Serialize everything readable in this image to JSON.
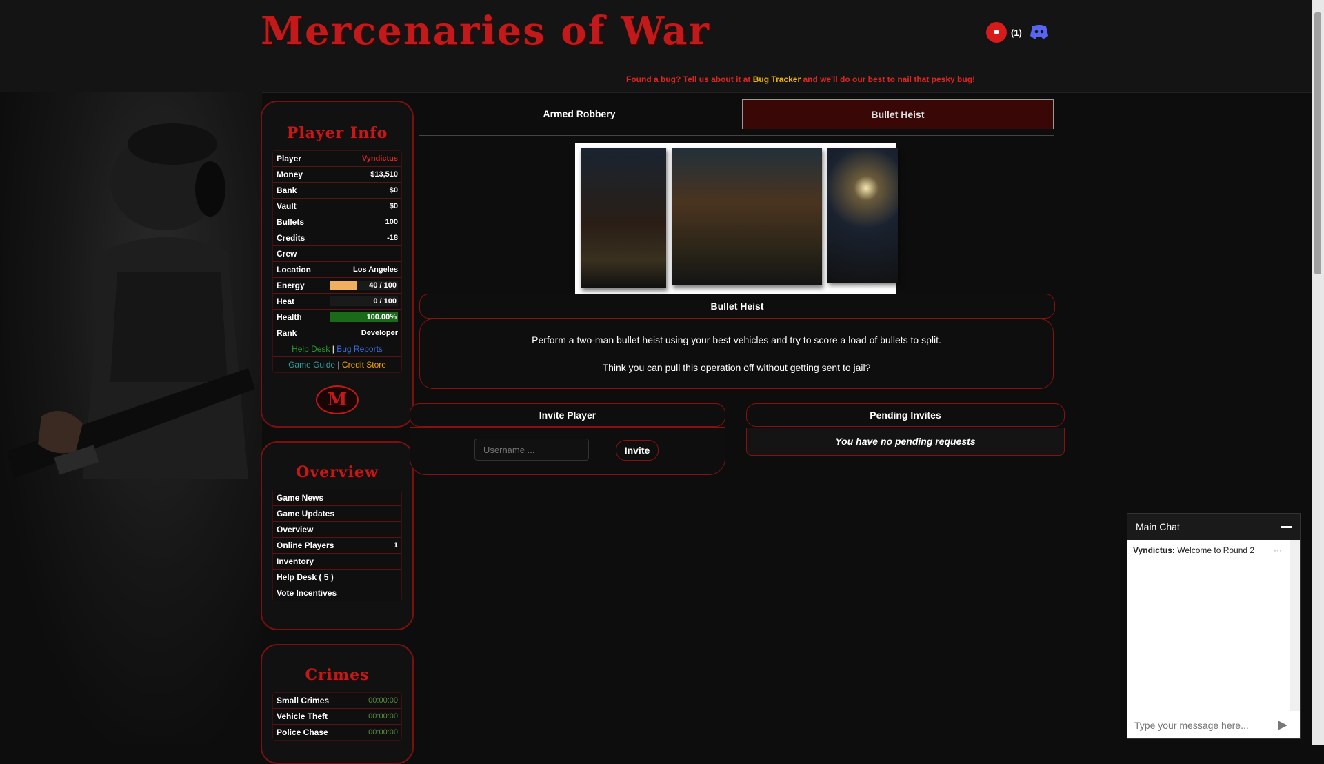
{
  "header": {
    "logo_text": "Mercenaries of War",
    "notification_count": "(1)",
    "bug_banner_pre": "Found a bug? Tell us about it at ",
    "bug_banner_link": "Bug Tracker",
    "bug_banner_post": " and we'll do our best to nail that pesky bug!"
  },
  "player_info": {
    "title": "Player Info",
    "rows": [
      {
        "label": "Player",
        "value": "Vyndictus"
      },
      {
        "label": "Money",
        "value": "$13,510"
      },
      {
        "label": "Bank",
        "value": "$0"
      },
      {
        "label": "Vault",
        "value": "$0"
      },
      {
        "label": "Bullets",
        "value": "100"
      },
      {
        "label": "Credits",
        "value": "-18"
      },
      {
        "label": "Crew",
        "value": ""
      },
      {
        "label": "Location",
        "value": "Los Angeles"
      }
    ],
    "energy": {
      "label": "Energy",
      "text": "40 / 100",
      "fraction": 0.4,
      "color": "#f0b060"
    },
    "heat": {
      "label": "Heat",
      "text": "0 / 100",
      "fraction": 0.0,
      "color": "#888888"
    },
    "health": {
      "label": "Health",
      "text": "100.00%",
      "fraction": 1.0,
      "color": "#1a6a1a"
    },
    "rank": {
      "label": "Rank",
      "value": "Developer"
    },
    "links1": {
      "help_desk": "Help Desk",
      "sep": " | ",
      "bug_reports": "Bug Reports"
    },
    "links2": {
      "game_guide": "Game Guide",
      "sep": " | ",
      "credit_store": "Credit Store"
    },
    "badge": "M"
  },
  "overview": {
    "title": "Overview",
    "items": [
      {
        "label": "Game News",
        "badge": ""
      },
      {
        "label": "Game Updates",
        "badge": ""
      },
      {
        "label": "Overview",
        "badge": ""
      },
      {
        "label": "Online Players",
        "badge": "1"
      },
      {
        "label": "Inventory",
        "badge": ""
      },
      {
        "label": "Help Desk ( 5 )",
        "badge": ""
      },
      {
        "label": "Vote Incentives",
        "badge": ""
      }
    ]
  },
  "crimes": {
    "title": "Crimes",
    "items": [
      {
        "label": "Small Crimes",
        "timer": "00:00:00"
      },
      {
        "label": "Vehicle Theft",
        "timer": "00:00:00"
      },
      {
        "label": "Police Chase",
        "timer": "00:00:00"
      }
    ]
  },
  "tabs": {
    "armed_robbery": "Armed Robbery",
    "bullet_heist": "Bullet Heist"
  },
  "heist": {
    "title": "Bullet Heist",
    "desc1": "Perform a two-man bullet heist using your best vehicles and try to score a load of bullets to split.",
    "desc2": "Think you can pull this operation off without getting sent to jail?"
  },
  "invite": {
    "title": "Invite Player",
    "placeholder": "Username ...",
    "button": "Invite"
  },
  "pending": {
    "title": "Pending Invites",
    "message": "You have no pending requests"
  },
  "chat": {
    "title": "Main Chat",
    "messages": [
      {
        "user": "Vyndictus:",
        "text": " Welcome to Round 2"
      }
    ],
    "more": "···",
    "placeholder": "Type your message here..."
  }
}
